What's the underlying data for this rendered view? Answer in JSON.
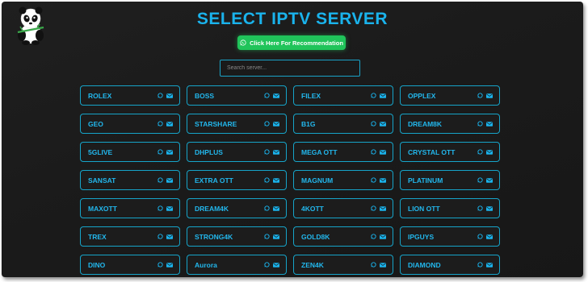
{
  "header": {
    "title": "SELECT IPTV SERVER",
    "recommend_button": "Click Here For Recommendation",
    "search_placeholder": "Search server..."
  },
  "icons": {
    "logo": "panda-logo-icon",
    "button": "whatsapp-icon",
    "card_icons": [
      "whatsapp-icon",
      "mail-icon"
    ]
  },
  "colors": {
    "accent": "#1ab3ec",
    "button": "#20c45a",
    "background": "#1c1c1c"
  },
  "servers": [
    "ROLEX",
    "BOSS",
    "FILEX",
    "OPPLEX",
    "GEO",
    "STARSHARE",
    "B1G",
    "DREAM8K",
    "5GLIVE",
    "DHPLUS",
    "MEGA OTT",
    "CRYSTAL OTT",
    "SANSAT",
    "EXTRA OTT",
    "MAGNUM",
    "PLATINUM",
    "MAXOTT",
    "DREAM4K",
    "4KOTT",
    "LION OTT",
    "TREX",
    "STRONG4K",
    "GOLD8K",
    "IPGUYS",
    "DINO",
    "Aurora",
    "ZEN4K",
    "DIAMOND"
  ]
}
